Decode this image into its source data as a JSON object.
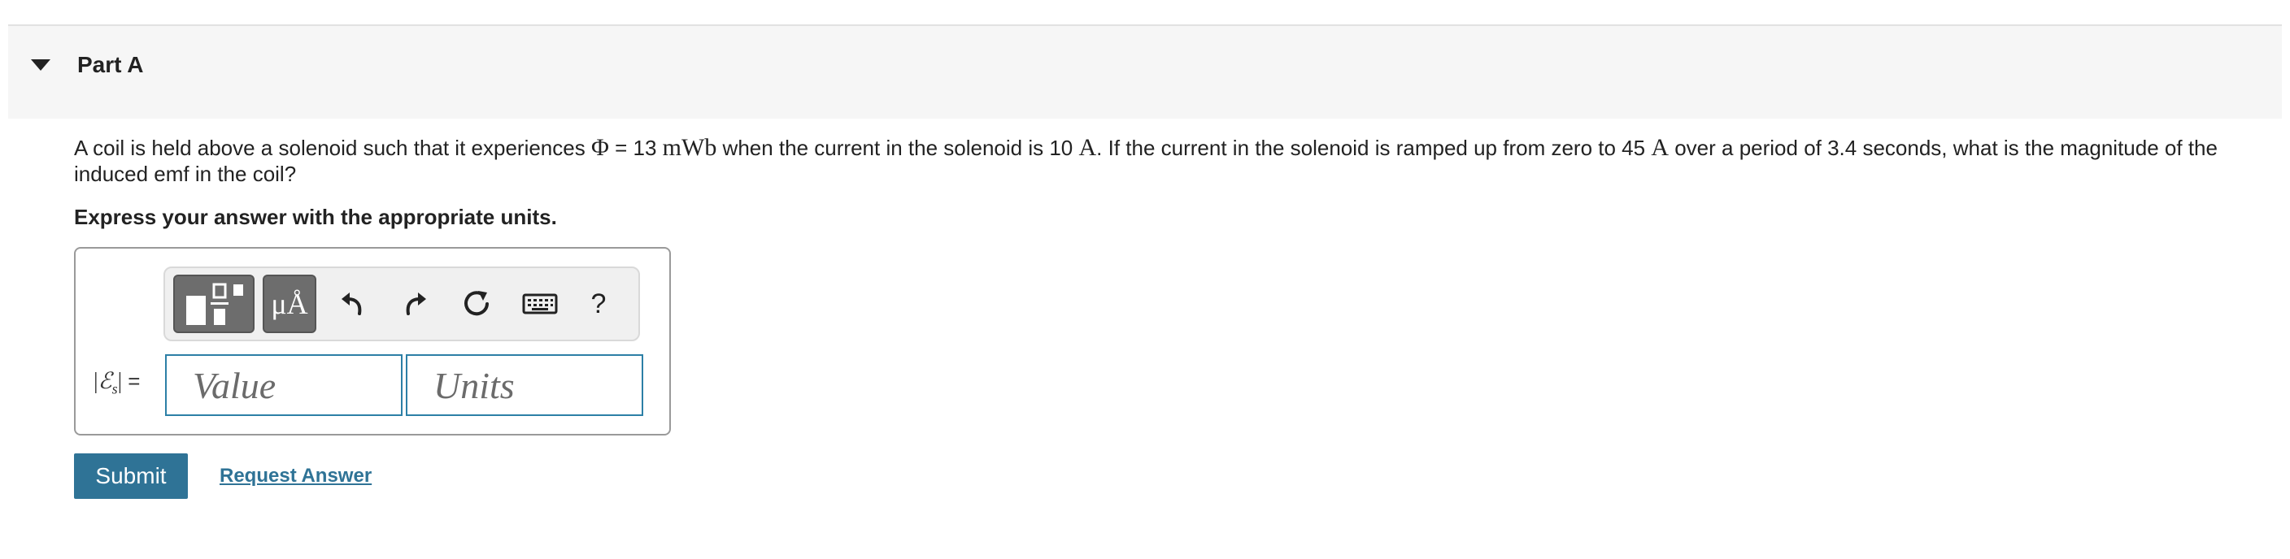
{
  "part": {
    "title": "Part A"
  },
  "question": {
    "t1": "A coil is held above a solenoid such that it experiences ",
    "flux_symbol": "Φ",
    "t2": " = 13 ",
    "flux_unit": "mWb",
    "t3": " when the current in the solenoid is 10 ",
    "amp1": "A",
    "t4": ". If the current in the solenoid is ramped up from zero to 45 ",
    "amp2": "A",
    "t5": " over a period of 3.4 seconds, what is the magnitude of the induced emf in the coil?"
  },
  "instruction": "Express your answer with the appropriate units.",
  "toolbar": {
    "units_label": "μÅ",
    "help_label": "?",
    "icons": [
      "templates-icon",
      "units-icon",
      "undo-icon",
      "redo-icon",
      "reset-icon",
      "keyboard-icon",
      "help-icon"
    ]
  },
  "answer": {
    "label_open": "|",
    "emf_symbol": "ℰ",
    "emf_sub": "s",
    "label_close": "| ",
    "equals": "=",
    "value_placeholder": "Value",
    "units_placeholder": "Units",
    "value": "",
    "units": ""
  },
  "actions": {
    "submit_label": "Submit",
    "request_label": "Request Answer"
  },
  "colors": {
    "accent": "#2f7396",
    "field_border": "#2c7fa6",
    "header_bg": "#f6f6f6"
  }
}
